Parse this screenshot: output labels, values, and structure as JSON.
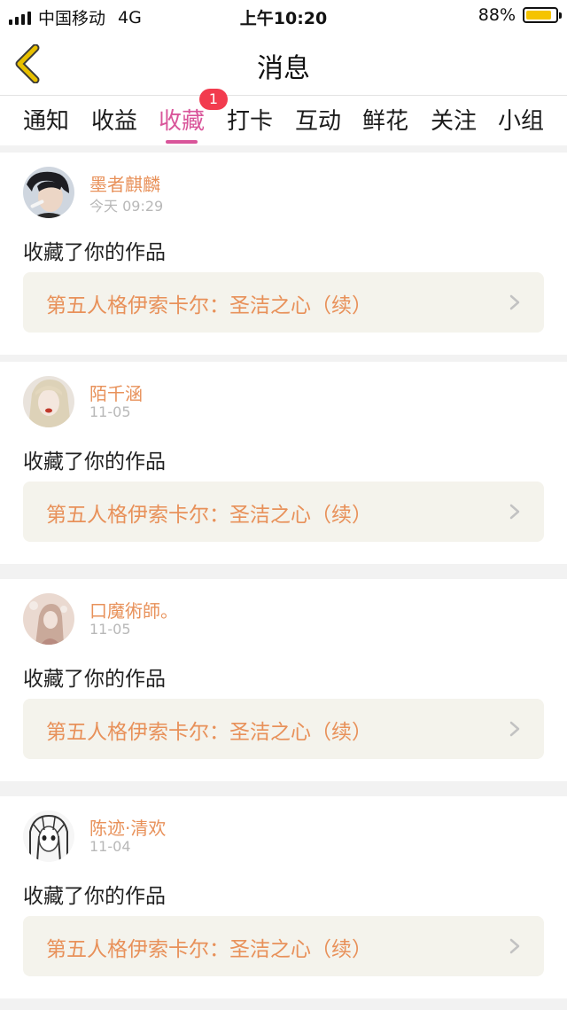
{
  "status_bar": {
    "carrier": "中国移动",
    "network": "4G",
    "time": "上午10:20",
    "battery_percent": "88%",
    "battery_level": 0.88
  },
  "nav": {
    "back_icon": "chevron-left-icon",
    "title": "消息"
  },
  "tabs": [
    {
      "label": "通知"
    },
    {
      "label": "收益"
    },
    {
      "label": "收藏",
      "badge": "1"
    },
    {
      "label": "打卡"
    },
    {
      "label": "互动"
    },
    {
      "label": "鲜花"
    },
    {
      "label": "关注"
    },
    {
      "label": "小组"
    }
  ],
  "active_tab": "收藏",
  "colors": {
    "accent_pink": "#d9559a",
    "badge_red": "#f23b4e",
    "name_orange": "#e8915a",
    "card_link_bg": "#f4f3ec",
    "back_icon_yellow": "#e8c000"
  },
  "notifications": [
    {
      "user": "墨者麒麟",
      "time": "今天 09:29",
      "message": "收藏了你的作品",
      "work": "第五人格伊索卡尔：圣洁之心（续）"
    },
    {
      "user": "陌千涵",
      "time": "11-05",
      "message": "收藏了你的作品",
      "work": "第五人格伊索卡尔：圣洁之心（续）"
    },
    {
      "user": "口魔術師。",
      "time": "11-05",
      "message": "收藏了你的作品",
      "work": "第五人格伊索卡尔：圣洁之心（续）"
    },
    {
      "user": "陈迹·清欢",
      "time": "11-04",
      "message": "收藏了你的作品",
      "work": "第五人格伊索卡尔：圣洁之心（续）"
    }
  ]
}
